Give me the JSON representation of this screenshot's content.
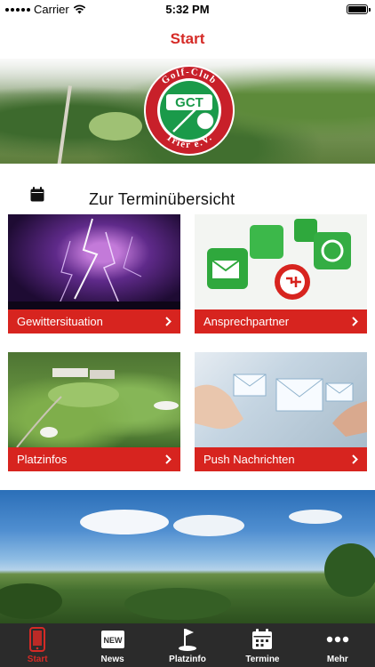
{
  "status_bar": {
    "carrier": "Carrier",
    "time": "5:32 PM"
  },
  "nav": {
    "title": "Start"
  },
  "hero": {
    "logo_text_top": "Golf-Club",
    "logo_text_bottom": "Trier e.V.",
    "logo_monogram": "GCT"
  },
  "terms": {
    "label": "Zur Terminübersicht"
  },
  "tiles": [
    {
      "label": "Gewittersituation"
    },
    {
      "label": "Ansprechpartner"
    },
    {
      "label": "Platzinfos"
    },
    {
      "label": "Push Nachrichten"
    }
  ],
  "tab_bar": {
    "tabs": [
      {
        "label": "Start",
        "icon": "phone-icon",
        "active": true
      },
      {
        "label": "News",
        "icon": "new-badge-icon",
        "badge_text": "NEW",
        "active": false
      },
      {
        "label": "Platzinfo",
        "icon": "golf-flag-icon",
        "active": false
      },
      {
        "label": "Termine",
        "icon": "calendar-icon",
        "active": false
      },
      {
        "label": "Mehr",
        "icon": "more-dots-icon",
        "active": false
      }
    ]
  },
  "colors": {
    "accent": "#d52a26",
    "tile_bar": "#d7241f",
    "tab_bar_bg": "#2b2b2b"
  }
}
